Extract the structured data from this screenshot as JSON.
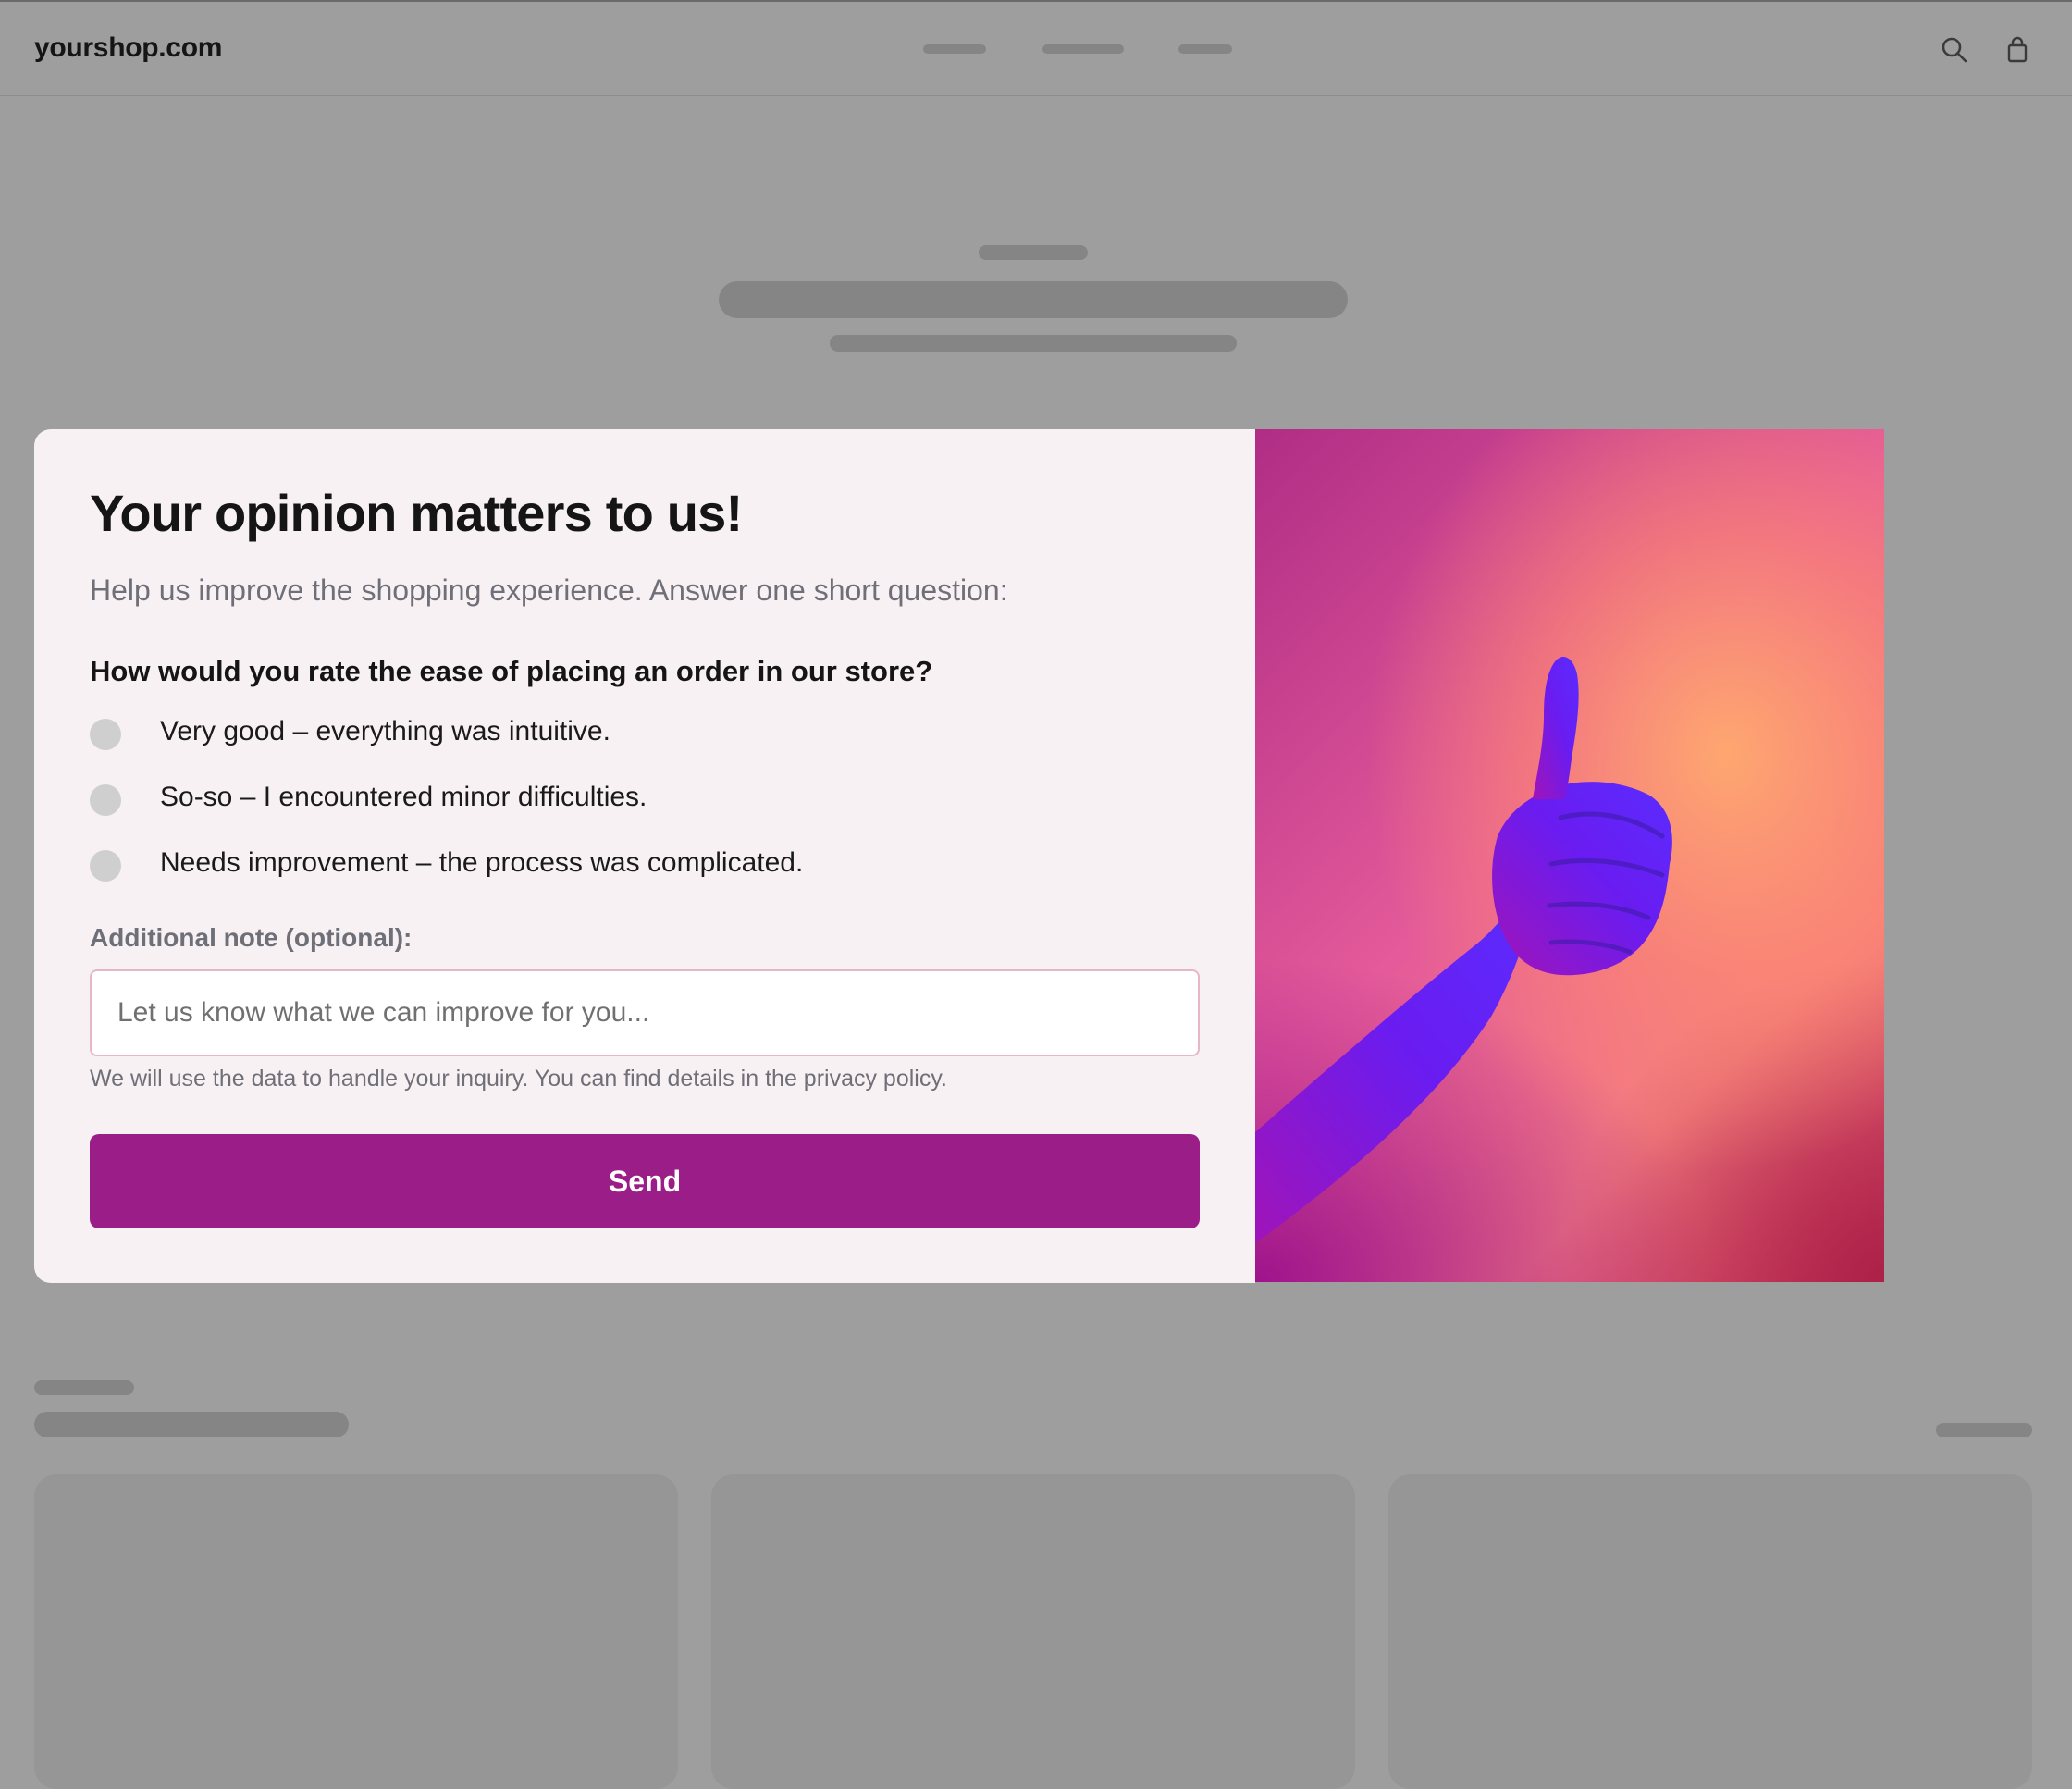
{
  "site": {
    "logo": "yourshop.com"
  },
  "header_icons": [
    "search-icon",
    "shopping-bag-icon"
  ],
  "modal": {
    "title": "Your opinion matters to us!",
    "subtitle": "Help us improve the shopping experience. Answer one short question:",
    "question": "How would you rate the ease of placing an order in our store?",
    "options": [
      {
        "label": "Very good – everything was intuitive.",
        "selected": false
      },
      {
        "label": "So-so – I encountered minor difficulties.",
        "selected": false
      },
      {
        "label": "Needs improvement – the process was complicated.",
        "selected": false
      }
    ],
    "note_label": "Additional note (optional):",
    "note_input": {
      "value": "",
      "placeholder": "Let us know what we can improve for you..."
    },
    "privacy_text": "We will use the data to handle your inquiry. You can find details in the privacy policy.",
    "send_label": "Send",
    "image_icon": "thumbs-up-hand-icon"
  },
  "colors": {
    "overlay": "#9e9e9e",
    "modal_bg": "#f8f1f4",
    "accent": "#9b1d88",
    "input_border": "#e8b7c6",
    "radio": "#cfcfcf"
  }
}
